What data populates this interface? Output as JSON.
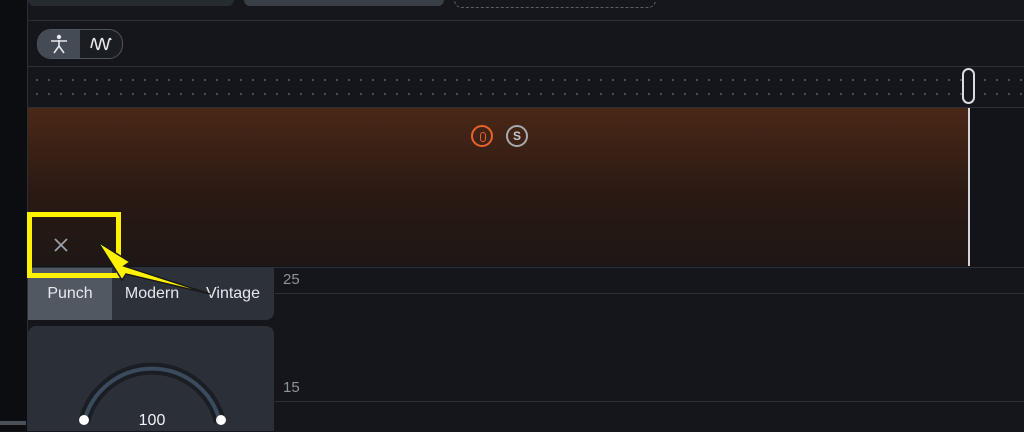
{
  "icons": {
    "figure": "figure-icon",
    "waveform": "waveform-icon",
    "record": "record-icon",
    "solo": "solo-icon",
    "close": "close-icon"
  },
  "track": {
    "solo_label": "S"
  },
  "presets": {
    "items": [
      "Punch",
      "Modern",
      "Vintage"
    ],
    "selected": "Punch"
  },
  "meter": {
    "labels": [
      "25",
      "15"
    ]
  },
  "knob": {
    "value": "100"
  },
  "colors": {
    "accent_record": "#e8622c",
    "highlight": "#fff200"
  }
}
